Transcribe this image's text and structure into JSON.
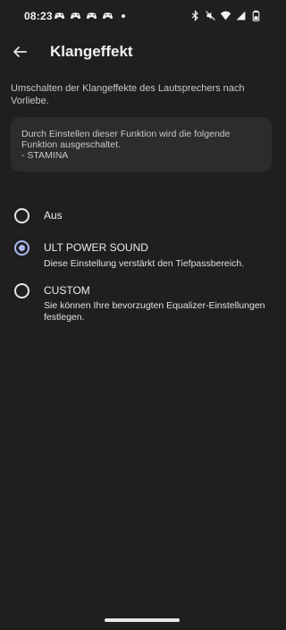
{
  "status_bar": {
    "time": "08:23",
    "notification_icons": [
      "game-controller-icon",
      "game-controller-icon",
      "game-controller-icon",
      "game-controller-icon"
    ],
    "system_icons": [
      "bluetooth-icon",
      "mute-icon",
      "wifi-icon",
      "signal-icon",
      "battery-icon"
    ]
  },
  "app_bar": {
    "back_icon": "arrow-left-icon",
    "title": "Klangeffekt"
  },
  "description": "Umschalten der Klangeffekte des Lautsprechers nach Vorliebe.",
  "info_box": {
    "text_line1": "Durch Einstellen dieser Funktion wird die folgende Funktion ausgeschaltet.",
    "text_line2": "- STAMINA"
  },
  "options": [
    {
      "label": "Aus",
      "description": "",
      "selected": false
    },
    {
      "label": "ULT POWER SOUND",
      "description": "Diese Einstellung verstärkt den Tiefpassbereich.",
      "selected": true
    },
    {
      "label": "CUSTOM",
      "description": "Sie können Ihre bevorzugten Equalizer-Einstellungen festlegen.",
      "selected": false
    }
  ],
  "colors": {
    "background": "#1f1f1f",
    "card": "#2c2c2c",
    "accent": "#a9b7f5"
  }
}
